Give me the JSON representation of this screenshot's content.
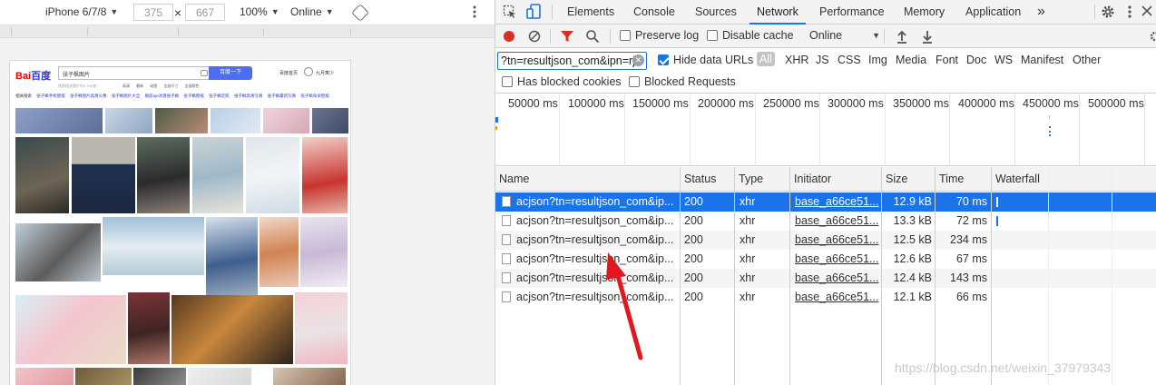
{
  "device_bar": {
    "device": "iPhone 6/7/8",
    "width": "375",
    "times": "×",
    "height": "667",
    "zoom": "100%",
    "throttle": "Online"
  },
  "baidu": {
    "logo_a": "Bai",
    "logo_b": "百度",
    "query": "张子枫图片",
    "search_btn": "百度一下",
    "home": "百度首页",
    "user": "九月寓少",
    "stats": "找到相关图片约2,700张",
    "filters": "高清 最新 动图 全部尺寸 全部颜色",
    "related_label": "相关搜索",
    "related": [
      "张子枫手机壁纸",
      "张子枫图片高清头像",
      "张子枫图片大全",
      "眼前aje冰激张子枫",
      "张子枫壁纸",
      "张子枫近照",
      "张子枫高清写真",
      "张子枫最新写真",
      "张子枫朵朵壁纸"
    ]
  },
  "devtools": {
    "tabs": [
      "Elements",
      "Console",
      "Sources",
      "Network",
      "Performance",
      "Memory",
      "Application"
    ],
    "active_tab": "Network",
    "more_tabs": "»",
    "toolbar": {
      "preserve_log": "Preserve log",
      "disable_cache": "Disable cache",
      "throttle": "Online"
    },
    "filter": {
      "value": "?tn=resultjson_com&ipn=rj",
      "hide_data_urls": "Hide data URLs",
      "types": [
        "All",
        "XHR",
        "JS",
        "CSS",
        "Img",
        "Media",
        "Font",
        "Doc",
        "WS",
        "Manifest",
        "Other"
      ],
      "has_blocked_cookies": "Has blocked cookies",
      "blocked_requests": "Blocked Requests"
    },
    "overview_ticks": [
      "50000 ms",
      "100000 ms",
      "150000 ms",
      "200000 ms",
      "250000 ms",
      "300000 ms",
      "350000 ms",
      "400000 ms",
      "450000 ms",
      "500000 ms"
    ],
    "columns": [
      "Name",
      "Status",
      "Type",
      "Initiator",
      "Size",
      "Time",
      "Waterfall"
    ],
    "rows": [
      {
        "name": "acjson?tn=resultjson_com&ip...",
        "status": "200",
        "type": "xhr",
        "initiator": "base_a66ce51...",
        "size": "12.9 kB",
        "time": "70 ms"
      },
      {
        "name": "acjson?tn=resultjson_com&ip...",
        "status": "200",
        "type": "xhr",
        "initiator": "base_a66ce51...",
        "size": "13.3 kB",
        "time": "72 ms"
      },
      {
        "name": "acjson?tn=resultjson_com&ip...",
        "status": "200",
        "type": "xhr",
        "initiator": "base_a66ce51...",
        "size": "12.5 kB",
        "time": "234 ms"
      },
      {
        "name": "acjson?tn=resultjson_com&ip...",
        "status": "200",
        "type": "xhr",
        "initiator": "base_a66ce51...",
        "size": "12.6 kB",
        "time": "67 ms"
      },
      {
        "name": "acjson?tn=resultjson_com&ip...",
        "status": "200",
        "type": "xhr",
        "initiator": "base_a66ce51...",
        "size": "12.4 kB",
        "time": "143 ms"
      },
      {
        "name": "acjson?tn=resultjson_com&ip...",
        "status": "200",
        "type": "xhr",
        "initiator": "base_a66ce51...",
        "size": "12.1 kB",
        "time": "66 ms"
      }
    ]
  },
  "watermark": "https://blog.csdn.net/weixin_37979343",
  "colors": {
    "accent": "#1a73e8",
    "record": "#d93025",
    "arrow": "#e3181e",
    "baidu_blue": "#4e6ef2"
  }
}
